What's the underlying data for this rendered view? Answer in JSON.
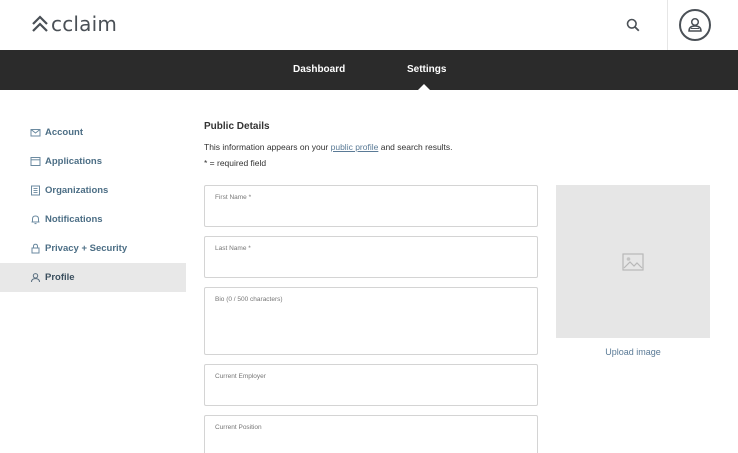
{
  "header": {
    "logo_text": "cclaim",
    "search_icon": "search-icon",
    "avatar_icon": "user-avatar-icon"
  },
  "nav": {
    "items": [
      {
        "label": "Dashboard",
        "active": false
      },
      {
        "label": "Settings",
        "active": true
      }
    ]
  },
  "sidebar": {
    "items": [
      {
        "label": "Account",
        "icon": "mail-icon"
      },
      {
        "label": "Applications",
        "icon": "window-icon"
      },
      {
        "label": "Organizations",
        "icon": "building-icon"
      },
      {
        "label": "Notifications",
        "icon": "bell-icon"
      },
      {
        "label": "Privacy + Security",
        "icon": "lock-icon"
      },
      {
        "label": "Profile",
        "icon": "profile-icon",
        "active": true
      }
    ]
  },
  "main": {
    "title": "Public Details",
    "info_prefix": "This information appears on your ",
    "info_link": "public profile",
    "info_suffix": " and search results.",
    "required_note": "* = required field",
    "fields": [
      {
        "label": "First Name *",
        "value": ""
      },
      {
        "label": "Last Name *",
        "value": ""
      },
      {
        "label": "Bio (0 / 500 characters)",
        "value": ""
      },
      {
        "label": "Current Employer",
        "value": ""
      },
      {
        "label": "Current Position",
        "value": ""
      }
    ],
    "image_icon": "image-placeholder-icon",
    "upload_label": "Upload image"
  },
  "colors": {
    "navbar_bg": "#2b2b2b",
    "link": "#5a7a96",
    "sidebar_text": "#4c6e85",
    "active_bg": "#e8e8e8"
  }
}
